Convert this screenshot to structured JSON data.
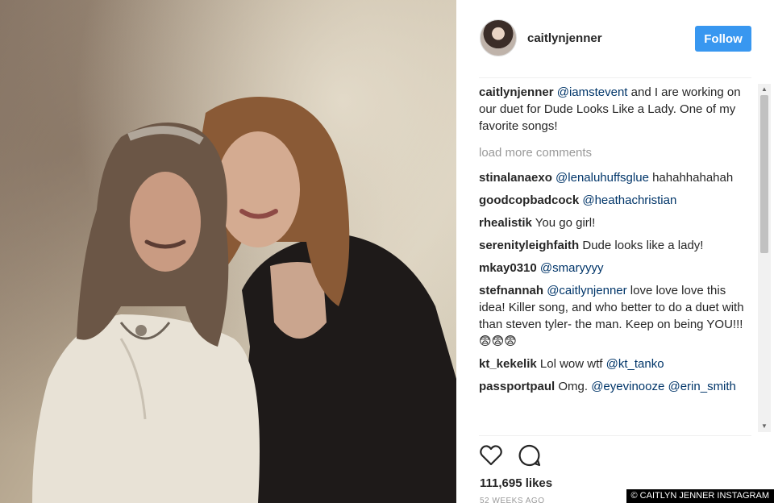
{
  "header": {
    "username": "caitlynjenner",
    "follow_label": "Follow"
  },
  "caption": {
    "user": "caitlynjenner",
    "mention": "@iamstevent",
    "text": " and I are working on our duet for Dude Looks Like a Lady. One of my favorite songs!"
  },
  "load_more_label": "load more comments",
  "comments": [
    {
      "user": "stinalanaexo",
      "mention": "@lenaluhuffsglue",
      "text": " hahahhahahah"
    },
    {
      "user": "goodcopbadcock",
      "mention": "@heathachristian",
      "text": ""
    },
    {
      "user": "rhealistik",
      "mention": "",
      "text": " You go girl!"
    },
    {
      "user": "serenityleighfaith",
      "mention": "",
      "text": " Dude looks like a lady!"
    },
    {
      "user": "mkay0310",
      "mention": "@smaryyyy",
      "text": ""
    },
    {
      "user": "stefnannah",
      "mention": "@caitlynjenner",
      "text": " love love love this idea! Killer song, and who better to do a duet with than steven tyler- the man. Keep on being YOU!!! 😨😨😨"
    },
    {
      "user": "kt_kekelik",
      "mention": "",
      "text": " Lol wow wtf ",
      "mention2": "@kt_tanko"
    },
    {
      "user": "passportpaul",
      "mention": "",
      "text": " Omg. ",
      "mention2": "@eyevinooze @erin_smith"
    }
  ],
  "icons": {
    "like": "heart-icon",
    "comment": "comment-icon"
  },
  "likes": "111,695 likes",
  "timestamp": "52 WEEKS AGO",
  "watermark": "© CAITLYN JENNER INSTAGRAM",
  "colors": {
    "follow_bg": "#3897f0",
    "mention": "#003569",
    "muted": "#999999"
  }
}
